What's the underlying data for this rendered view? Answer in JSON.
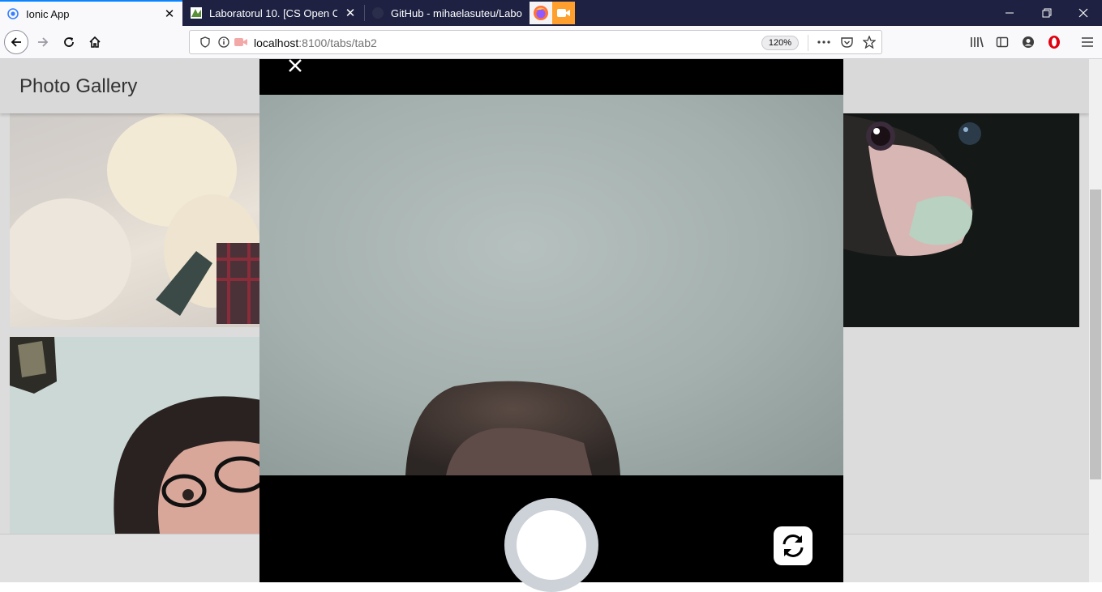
{
  "browser": {
    "tabs": [
      {
        "title": "Ionic App",
        "active": true
      },
      {
        "title": "Laboratorul 10. [CS Open Cour",
        "active": false
      },
      {
        "title": "GitHub - mihaelasuteu/Laborat",
        "active": false
      }
    ],
    "url": {
      "host": "localhost",
      "path": ":8100/tabs/tab2"
    },
    "zoom": "120%"
  },
  "app": {
    "title": "Photo Gallery"
  },
  "colors": {
    "tabstrip": "#1e2142",
    "header": "#d9d9d9",
    "camera_bg": "#000000",
    "shutter_ring": "#cdd1d8"
  },
  "icons": {
    "back": "arrow-left-icon",
    "forward": "arrow-right-icon",
    "reload": "reload-icon",
    "home": "home-icon",
    "library": "library-icon",
    "sidebar": "sidebar-icon",
    "account": "account-icon",
    "opera": "opera-icon",
    "menu": "hamburger-icon",
    "close_camera": "close-icon",
    "flip_camera": "camera-flip-icon"
  }
}
